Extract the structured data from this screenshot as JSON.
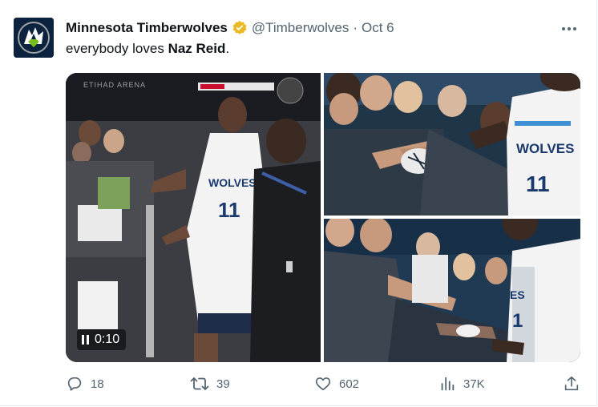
{
  "tweet": {
    "author_name": "Minnesota Timberwolves",
    "handle": "@Timberwolves",
    "separator": "·",
    "date": "Oct 6",
    "text_prefix": "everybody loves ",
    "text_bold": "Naz Reid",
    "text_suffix": "."
  },
  "media": {
    "arena_sign": "ETIHAD ARENA",
    "jersey_text": "WOLVES",
    "jersey_number": "11",
    "video_time": "0:10"
  },
  "actions": {
    "replies": "18",
    "retweets": "39",
    "likes": "602",
    "views": "37K"
  },
  "colors": {
    "verified": "#e8b923",
    "text_secondary": "#536471",
    "brand_navy": "#0c2340"
  }
}
